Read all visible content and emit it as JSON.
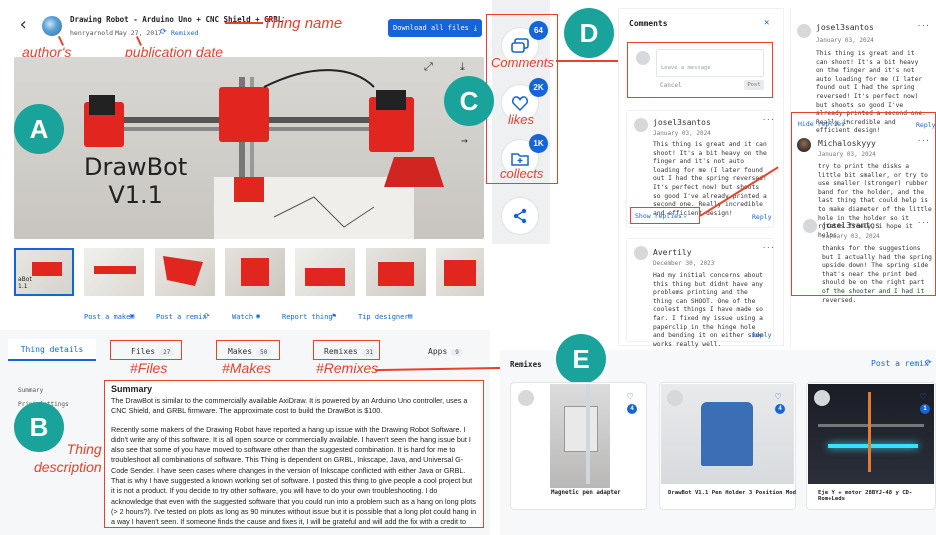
{
  "annotations": {
    "thing_name": "Thing name",
    "authors_username": "author's\nusername",
    "publication_date": "publication date",
    "files": "#Files",
    "makes": "#Makes",
    "remixes": "#Remixes",
    "thing_description": "Thing\ndescription",
    "comments": "Comments",
    "likes": "likes",
    "collects": "collects",
    "A": "A",
    "B": "B",
    "C": "C",
    "D": "D",
    "E": "E"
  },
  "header": {
    "back_glyph": "‹",
    "title": "Drawing Robot - Arduino Uno + CNC Shield + GRBL",
    "username": "henryarnold",
    "date": "May 27, 2017",
    "remixed": "Remixed",
    "download_label": "Download all files"
  },
  "image": {
    "caption_line1": "DrawBot",
    "caption_line2": "V1.1",
    "thumb_label": "aBot\n1.1"
  },
  "actions": {
    "post_make": "Post a make",
    "post_remix": "Post a remix",
    "watch": "Watch",
    "report": "Report thing",
    "tip": "Tip designer"
  },
  "side": {
    "comments_count": "64",
    "likes_count": "2K",
    "collects_count": "1K"
  },
  "tabs": {
    "details": "Thing details",
    "files": "Files",
    "files_count": "27",
    "makes": "Makes",
    "makes_count": "50",
    "remixes": "Remixes",
    "remixes_count": "31",
    "apps": "Apps",
    "apps_count": "9"
  },
  "sidebar_nav": {
    "summary": "Summary",
    "print_settings": "Print Settings"
  },
  "description": {
    "heading": "Summary",
    "p1": "The DrawBot is similar to the commercially available AxiDraw. It is powered by an Arduino Uno controller, uses a CNC Shield, and GRBL firmware. The approximate cost to build the DrawBot is $100.",
    "p2": "Recently some makers of the Drawing Robot have reported a hang up issue with the Drawing Robot Software. I didn't write any of this software. It is all open source or commercially available. I haven't seen the hang issue but I also see that some of you have moved to software other than the suggested combination. It is hard for me to troubleshoot all combinations of software. This Thing is dependent on GRBL, Inkscape, Java, and Universal G-Code Sender. I have seen cases where changes in the version of Inkscape conflicted with either Java or GRBL. That is why I have suggested a known working set of software. I posted this thing to give people a cool project but it is not a product. If you decide to try other software, you will have to do your own troubleshooting. I do acknowledge that even with the suggested software that you could run into a problem such as a hang on long plots (> 2 hours?). I've tested on plots as long as 90 minutes without issue but it is possible that a long plot could hang in a way I haven't seen. If someone finds the cause and fixes it, I will be grateful and will add the fix with a credit to you."
  },
  "comments_panel": {
    "title": "Comments",
    "close": "✕",
    "placeholder": "Leave a message",
    "cancel": "Cancel",
    "post": "Post",
    "c1": {
      "name": "josel3santos",
      "date": "January 03, 2024",
      "body": "This thing is great and it can shoot! It's a bit heavy on the finger and it's not auto loading for me (I later found out I had the spring reversed! It's perfect now) but shoots so good I've already printed a second one. Really incredible and efficient design!",
      "show_replies": "Show replies",
      "reply": "Reply"
    },
    "c2": {
      "name": "Avertily",
      "date": "December 30, 2023",
      "body": "Had my initial concerns about this thing but didnt have any problems printing and the thing can SHOOT. One of the coolest things I have made so far. I fixed my issue using a paperclip in the hinge hole and bending it on either side works really well.",
      "reply": "Reply"
    },
    "menu": "···"
  },
  "replies_panel": {
    "c1_name": "josel3santos",
    "c1_date": "January 03, 2024",
    "c1_body": "This thing is great and it can shoot! It's a bit heavy on the finger and it's not auto loading for me (I later found out I had the spring reversed! It's perfect now) but shoots so good I've already printed a second one. Really incredible and efficient design!",
    "hide_replies": "Hide replies",
    "reply": "Reply",
    "r1_name": "Michaloskyyy",
    "r1_date": "January 03, 2024",
    "r1_body": "try to print the disks a little bit smaller, or try to use smaller (stronger) rubber band for the holder, and the last thing that could help is to make diameter of the little hole in the holder so it rotates freely, i hope it helps",
    "r2_name": "josel3santos",
    "r2_date": "January 03, 2024",
    "r2_body": "thanks for the suggestions but I actually had the spring upside down! The spring side that's near the print bed should be on the right part of the shooter and I had it reversed.",
    "menu": "···"
  },
  "remixes": {
    "title": "Remixes",
    "post_remix": "Post a remix",
    "items": [
      {
        "title": "Magnetic pen adapter",
        "likes": "4"
      },
      {
        "title": "DrawBot V1.1 Pen Holder 3 Position Mod",
        "likes": "4"
      },
      {
        "title": "Eje Y + motor 28BYJ-48 y CD-Rom+Leds",
        "likes": "1"
      }
    ]
  },
  "colors": {
    "accent": "#1565d8",
    "annotation": "#e8412c",
    "badge": "#1aa39a",
    "robot_red": "#e0261e"
  }
}
